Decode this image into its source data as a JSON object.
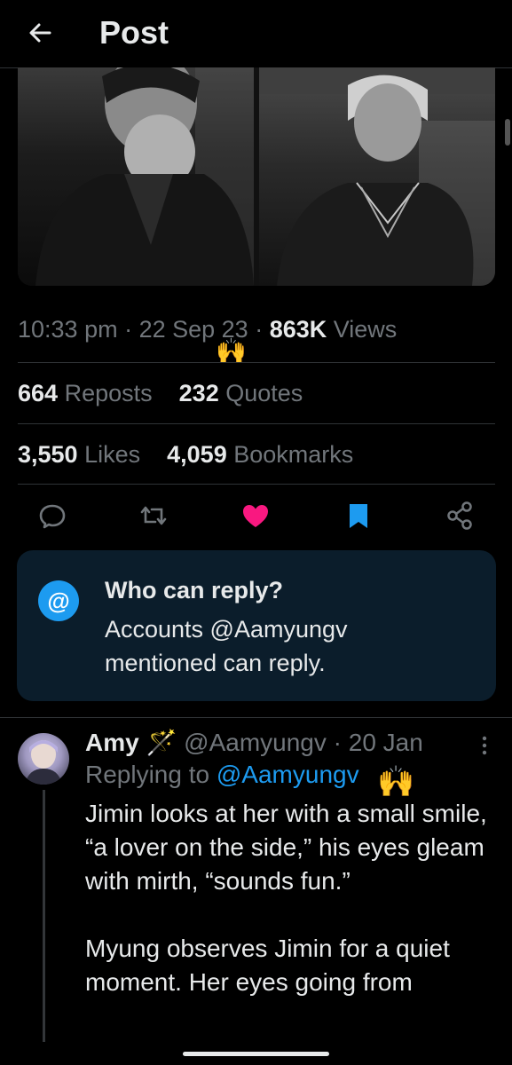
{
  "header": {
    "title": "Post"
  },
  "post": {
    "time": "10:33 pm",
    "date": "22 Sep 23",
    "views_count": "863K",
    "views_label": "Views",
    "reposts_count": "664",
    "reposts_label": "Reposts",
    "quotes_count": "232",
    "quotes_label": "Quotes",
    "likes_count": "3,550",
    "likes_label": "Likes",
    "bookmarks_count": "4,059",
    "bookmarks_label": "Bookmarks",
    "emoji": "🙌"
  },
  "actions": {
    "icons": [
      "reply-icon",
      "repost-icon",
      "like-icon",
      "bookmark-icon",
      "share-icon"
    ],
    "like_color": "#f91880",
    "bookmark_color": "#1d9bf0"
  },
  "reply_restriction": {
    "icon": "at-symbol",
    "symbol": "@",
    "title": "Who can reply?",
    "body": "Accounts @Aamyungv mentioned can reply."
  },
  "reply_tweet": {
    "name": "Amy",
    "name_emoji": "🪄",
    "handle": "@Aamyungv",
    "date": "20 Jan",
    "replying_prefix": "Replying to",
    "replying_to": "@Aamyungv",
    "emoji": "🙌",
    "paragraphs": [
      "Jimin looks at her with a small smile, “a lover on the side,” his eyes gleam with mirth, “sounds fun.”",
      "Myung observes Jimin for a quiet moment. Her eyes going from"
    ]
  },
  "colors": {
    "background": "#000000",
    "text": "#e7e9ea",
    "secondary": "#71767b",
    "accent": "#1d9bf0",
    "card": "#0b1d2b"
  }
}
